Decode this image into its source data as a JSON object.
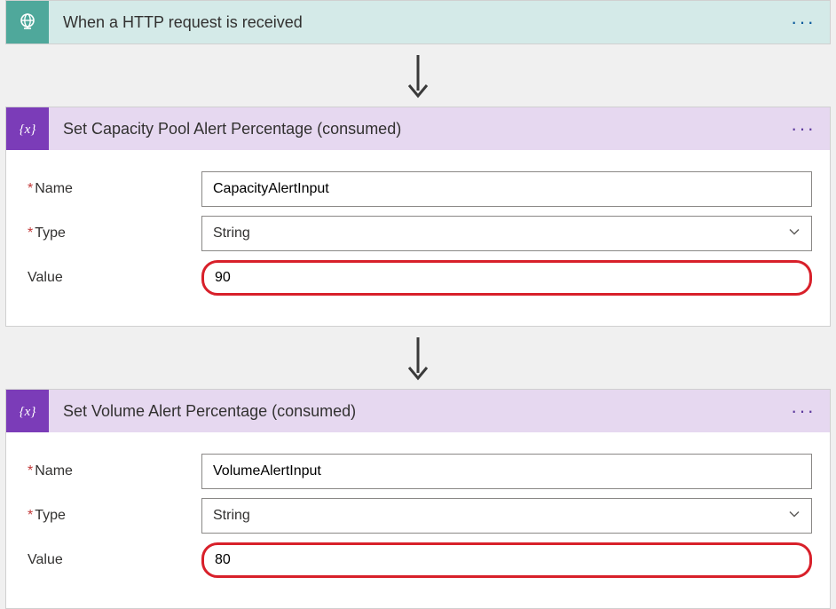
{
  "trigger": {
    "title": "When a HTTP request is received"
  },
  "step1": {
    "title": "Set Capacity Pool Alert Percentage (consumed)",
    "name_label": "Name",
    "name_value": "CapacityAlertInput",
    "type_label": "Type",
    "type_value": "String",
    "value_label": "Value",
    "value_value": "90"
  },
  "step2": {
    "title": "Set Volume Alert Percentage (consumed)",
    "name_label": "Name",
    "name_value": "VolumeAlertInput",
    "type_label": "Type",
    "type_value": "String",
    "value_label": "Value",
    "value_value": "80"
  },
  "glyphs": {
    "more": "···"
  }
}
